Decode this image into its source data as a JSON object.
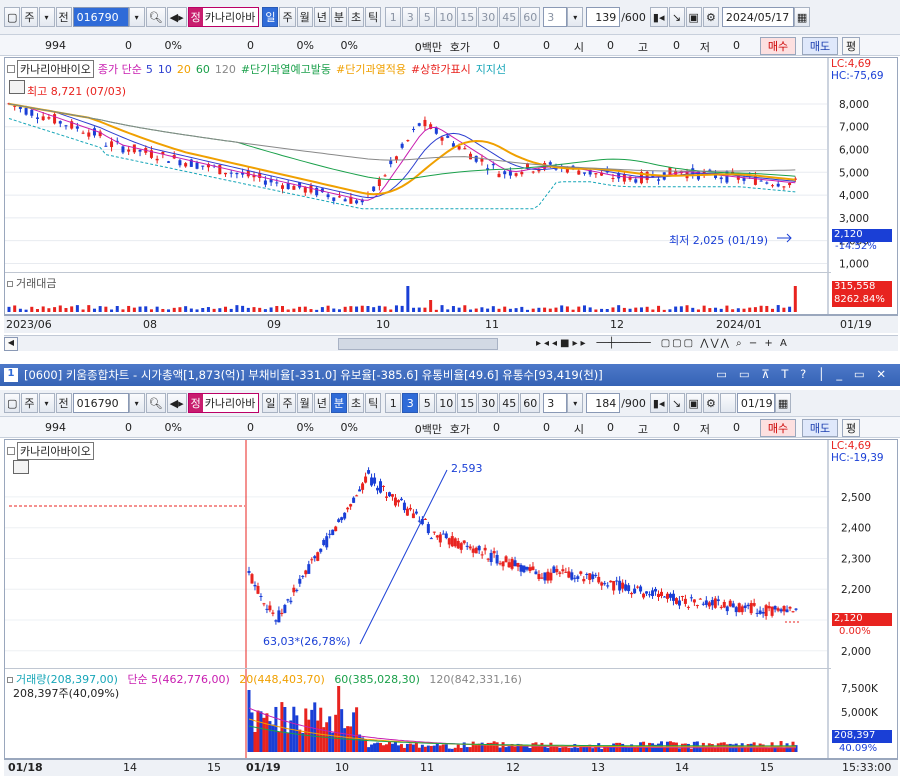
{
  "top": {
    "toolbar": {
      "type_label": "주",
      "prefix_label": "전",
      "code": "016790",
      "name_tag": "정",
      "name": "카나리아바",
      "periods": [
        "일",
        "주",
        "월",
        "년",
        "분",
        "초",
        "틱"
      ],
      "selected_period": "일",
      "minutes": [
        "1",
        "3",
        "5",
        "10",
        "15",
        "30",
        "45",
        "60"
      ],
      "interval_value": "3",
      "count": "139",
      "count_max": "/600",
      "date": "2024/05/17"
    },
    "quote": {
      "price": "994",
      "change": "0",
      "rate": "0%",
      "volume": "0",
      "vol_rate": "0%",
      "turnover_rate": "0%",
      "amount": "0백만",
      "hoga_label": "호가",
      "hoga1": "0",
      "hoga2": "0",
      "open_label": "시",
      "open": "0",
      "high_label": "고",
      "high": "0",
      "low_label": "저",
      "low": "0",
      "buy": "매수",
      "sell": "매도",
      "flat": "평"
    },
    "legend": {
      "name": "카나리아바이오",
      "items": [
        "종가 단순",
        "5",
        "10",
        "20",
        "60",
        "120",
        "#단기과열예고발동",
        "#단기과열적용",
        "#상한가표시",
        "지지선"
      ],
      "lc": "LC:4,69",
      "hc": "HC:-75,69"
    },
    "annotations": {
      "high": "최고 8,721 (07/03)",
      "low": "최저 2,025 (01/19)"
    },
    "yaxis": [
      "8,000",
      "7,000",
      "6,000",
      "5,000",
      "4,000",
      "3,000",
      "2,000",
      "1,000"
    ],
    "current_price": "2,120",
    "current_rate": "-14.52%",
    "volume_legend": "거래대금",
    "volume_value": "315,558",
    "volume_rate": "8262.84%",
    "xaxis": [
      "2023/06",
      "08",
      "09",
      "10",
      "11",
      "12",
      "2024/01"
    ],
    "xaxis_end": "01/19"
  },
  "bottom": {
    "title": "[0600] 키움종합차트 - 시가총액[1,873(억)] 부채비율[-331.0] 유보율[-385.6] 유통비율[49.6] 유통수[93,419(천)]",
    "window_index": "1",
    "toolbar": {
      "type_label": "주",
      "prefix_label": "전",
      "code": "016790",
      "name_tag": "정",
      "name": "카나리아바",
      "periods": [
        "일",
        "주",
        "월",
        "년",
        "분",
        "초",
        "틱"
      ],
      "selected_period": "분",
      "minutes": [
        "1",
        "3",
        "5",
        "10",
        "15",
        "30",
        "45",
        "60"
      ],
      "selected_minute": "3",
      "interval_value": "3",
      "count": "184",
      "count_max": "/900",
      "date": "01/19"
    },
    "quote": {
      "price": "994",
      "change": "0",
      "rate": "0%",
      "volume": "0",
      "vol_rate": "0%",
      "turnover_rate": "0%",
      "amount": "0백만",
      "hoga_label": "호가",
      "hoga1": "0",
      "hoga2": "0",
      "open_label": "시",
      "open": "0",
      "high_label": "고",
      "high": "0",
      "low_label": "저",
      "low": "0",
      "buy": "매수",
      "sell": "매도",
      "flat": "평"
    },
    "legend": {
      "name": "카나리아바이오",
      "lc": "LC:4,69",
      "hc": "HC:-19,39"
    },
    "annotations": {
      "peak": "2,593",
      "low": "63,03*(26,78%)"
    },
    "yaxis": [
      "2,500",
      "2,400",
      "2,300",
      "2,200",
      "2,100",
      "2,000"
    ],
    "current_price": "2,120",
    "current_rate": "0.00%",
    "volume_legend": {
      "vol": "거래량(208,397,00)",
      "ma5": "단순 5(462,776,00)",
      "ma20": "20(448,403,70)",
      "ma60": "60(385,028,30)",
      "ma120": "120(842,331,16)"
    },
    "volume_sub": "208,397주(40,09%)",
    "volume_yaxis": [
      "7,500K",
      "5,000K",
      "2,500K"
    ],
    "volume_value": "208,397",
    "volume_rate": "40.09%",
    "xaxis": [
      "01/18",
      "14",
      "15",
      "01/19",
      "10",
      "11",
      "12",
      "13",
      "14",
      "15"
    ],
    "time": "15:33:00"
  },
  "colors": {
    "up": "#e8231f",
    "down": "#1a3fd6",
    "ma5": "#c81db0",
    "ma10": "#2d3fd0",
    "ma20": "#f0a000",
    "ma60": "#1aa04a",
    "ma120": "#888888",
    "support": "#17a6b8"
  }
}
